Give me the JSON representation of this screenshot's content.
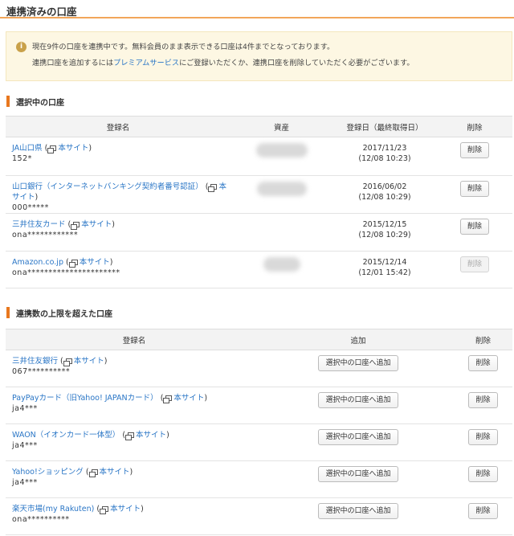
{
  "page": {
    "title": "連携済みの口座"
  },
  "notice": {
    "icon": "info-icon",
    "line1": "現在9件の口座を連携中です。無料会員のまま表示できる口座は4件までとなっております。",
    "line2_pre": "連携口座を追加するには",
    "line2_link": "プレミアムサービス",
    "line2_post": "にご登録いただくか、連携口座を削除していただく必要がございます。"
  },
  "selected": {
    "title": "選択中の口座",
    "headers": {
      "name": "登録名",
      "asset": "資産",
      "date": "登録日（最終取得日）",
      "delete": "削除"
    },
    "site_label": "本サイト",
    "delete_label": "削除",
    "rows": [
      {
        "name": "JA山口県",
        "id": "152*",
        "date": "2017/11/23",
        "last": "(12/08 10:23)"
      },
      {
        "name": "山口銀行（インターネットバンキング契約者番号認証）",
        "id": "000*****",
        "date": "2016/06/02",
        "last": "(12/08 10:29)"
      },
      {
        "name": "三井住友カード",
        "id": "ona************",
        "date": "2015/12/15",
        "last": "(12/08 10:29)"
      },
      {
        "name": "Amazon.co.jp",
        "id": "ona**********************",
        "date": "2015/12/14",
        "last": "(12/01 15:42)"
      }
    ]
  },
  "over": {
    "title": "連携数の上限を超えた口座",
    "headers": {
      "name": "登録名",
      "add": "追加",
      "delete": "削除"
    },
    "site_label": "本サイト",
    "add_label": "選択中の口座へ追加",
    "delete_label": "削除",
    "rows": [
      {
        "name": "三井住友銀行",
        "id": "067**********"
      },
      {
        "name": "PayPayカード（旧Yahoo! JAPANカード）",
        "id": "ja4***"
      },
      {
        "name": "WAON（イオンカード一体型）",
        "id": "ja4***"
      },
      {
        "name": "Yahoo!ショッピング",
        "id": "ja4***"
      },
      {
        "name": "楽天市場(my Rakuten)",
        "id": "ona**********"
      }
    ]
  }
}
